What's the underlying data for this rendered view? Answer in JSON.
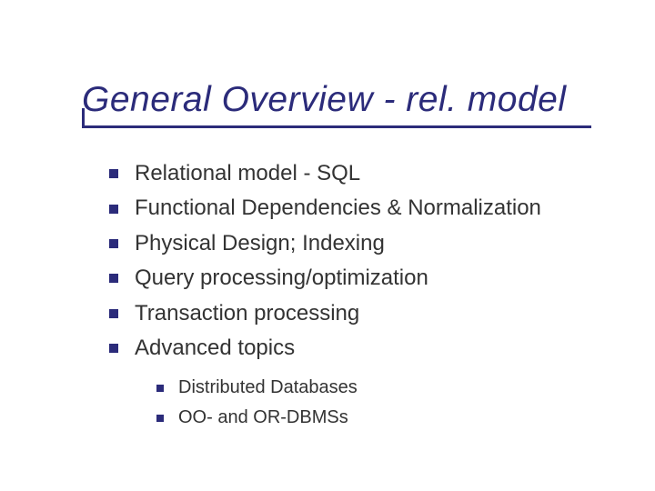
{
  "title": "General Overview - rel. model",
  "bullets": [
    "Relational model - SQL",
    "Functional Dependencies & Normalization",
    "Physical Design; Indexing",
    "Query processing/optimization",
    "Transaction processing",
    "Advanced topics"
  ],
  "sub_bullets": [
    "Distributed Databases",
    "OO- and OR-DBMSs"
  ]
}
